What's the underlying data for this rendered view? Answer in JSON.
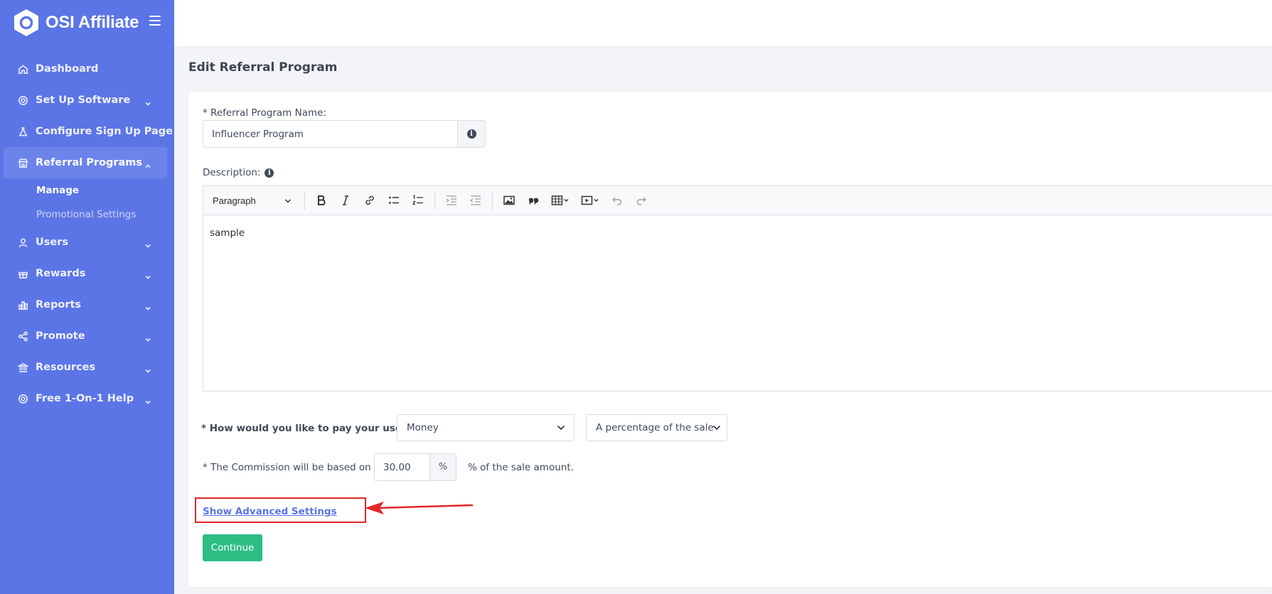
{
  "app": {
    "name": "OSI Affiliate"
  },
  "sidebar": {
    "items": [
      {
        "label": "Dashboard",
        "icon": "home-icon"
      },
      {
        "label": "Set Up Software",
        "icon": "gear-icon"
      },
      {
        "label": "Configure Sign Up Page",
        "icon": "flask-icon"
      },
      {
        "label": "Referral Programs",
        "icon": "store-icon"
      },
      {
        "label": "Users",
        "icon": "user-icon"
      },
      {
        "label": "Rewards",
        "icon": "gift-icon"
      },
      {
        "label": "Reports",
        "icon": "bar-chart-icon"
      },
      {
        "label": "Promote",
        "icon": "share-icon"
      },
      {
        "label": "Resources",
        "icon": "bank-icon"
      },
      {
        "label": "Free 1-On-1 Help",
        "icon": "lifebuoy-icon"
      }
    ],
    "submenu": [
      {
        "label": "Manage"
      },
      {
        "label": "Promotional Settings"
      }
    ]
  },
  "page": {
    "title": "Edit Referral Program"
  },
  "form": {
    "program_name_label": "* Referral Program Name:",
    "program_name_value": "Influencer Program",
    "description_label": "Description:",
    "editor": {
      "paragraph_select": "Paragraph",
      "content": "sample"
    },
    "pay_label": "* How would you like to pay your users:",
    "pay_type": "Money",
    "pay_basis": "A percentage of the sale",
    "commission_label": "* The Commission will be based on",
    "commission_value": "30.00",
    "commission_unit": "%",
    "commission_suffix": "% of the sale amount.",
    "advanced_link": "Show Advanced Settings",
    "continue_label": "Continue"
  },
  "colors": {
    "sidebar": "#5c75e6",
    "accent": "#5c75e6",
    "continue_button": "#2ebd85",
    "highlight_annotation": "#e3262b"
  }
}
